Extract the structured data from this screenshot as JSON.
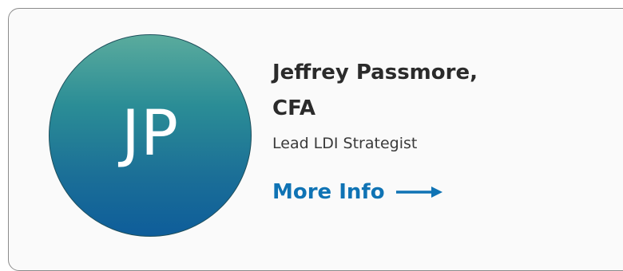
{
  "profile": {
    "initials": "JP",
    "name_line1": "Jeffrey Passmore,",
    "name_line2": "CFA",
    "role": "Lead LDI Strategist",
    "more_info_label": "More Info",
    "arrow_icon": "arrow-right-icon"
  },
  "colors": {
    "accent": "#0f73b4",
    "avatar_gradient_top": "#5aab9d",
    "avatar_gradient_bottom": "#0e5d9a",
    "name_text": "#2b2b2b"
  }
}
